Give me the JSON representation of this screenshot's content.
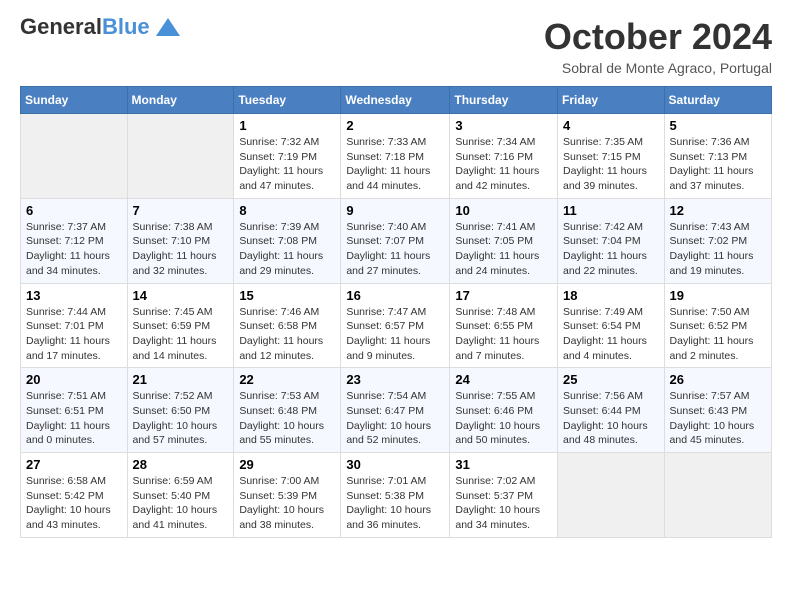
{
  "header": {
    "logo_line1": "General",
    "logo_line2": "Blue",
    "month": "October 2024",
    "location": "Sobral de Monte Agraco, Portugal"
  },
  "days_of_week": [
    "Sunday",
    "Monday",
    "Tuesday",
    "Wednesday",
    "Thursday",
    "Friday",
    "Saturday"
  ],
  "weeks": [
    [
      {
        "day": null,
        "sunrise": null,
        "sunset": null,
        "daylight": null
      },
      {
        "day": null,
        "sunrise": null,
        "sunset": null,
        "daylight": null
      },
      {
        "day": "1",
        "sunrise": "Sunrise: 7:32 AM",
        "sunset": "Sunset: 7:19 PM",
        "daylight": "Daylight: 11 hours and 47 minutes."
      },
      {
        "day": "2",
        "sunrise": "Sunrise: 7:33 AM",
        "sunset": "Sunset: 7:18 PM",
        "daylight": "Daylight: 11 hours and 44 minutes."
      },
      {
        "day": "3",
        "sunrise": "Sunrise: 7:34 AM",
        "sunset": "Sunset: 7:16 PM",
        "daylight": "Daylight: 11 hours and 42 minutes."
      },
      {
        "day": "4",
        "sunrise": "Sunrise: 7:35 AM",
        "sunset": "Sunset: 7:15 PM",
        "daylight": "Daylight: 11 hours and 39 minutes."
      },
      {
        "day": "5",
        "sunrise": "Sunrise: 7:36 AM",
        "sunset": "Sunset: 7:13 PM",
        "daylight": "Daylight: 11 hours and 37 minutes."
      }
    ],
    [
      {
        "day": "6",
        "sunrise": "Sunrise: 7:37 AM",
        "sunset": "Sunset: 7:12 PM",
        "daylight": "Daylight: 11 hours and 34 minutes."
      },
      {
        "day": "7",
        "sunrise": "Sunrise: 7:38 AM",
        "sunset": "Sunset: 7:10 PM",
        "daylight": "Daylight: 11 hours and 32 minutes."
      },
      {
        "day": "8",
        "sunrise": "Sunrise: 7:39 AM",
        "sunset": "Sunset: 7:08 PM",
        "daylight": "Daylight: 11 hours and 29 minutes."
      },
      {
        "day": "9",
        "sunrise": "Sunrise: 7:40 AM",
        "sunset": "Sunset: 7:07 PM",
        "daylight": "Daylight: 11 hours and 27 minutes."
      },
      {
        "day": "10",
        "sunrise": "Sunrise: 7:41 AM",
        "sunset": "Sunset: 7:05 PM",
        "daylight": "Daylight: 11 hours and 24 minutes."
      },
      {
        "day": "11",
        "sunrise": "Sunrise: 7:42 AM",
        "sunset": "Sunset: 7:04 PM",
        "daylight": "Daylight: 11 hours and 22 minutes."
      },
      {
        "day": "12",
        "sunrise": "Sunrise: 7:43 AM",
        "sunset": "Sunset: 7:02 PM",
        "daylight": "Daylight: 11 hours and 19 minutes."
      }
    ],
    [
      {
        "day": "13",
        "sunrise": "Sunrise: 7:44 AM",
        "sunset": "Sunset: 7:01 PM",
        "daylight": "Daylight: 11 hours and 17 minutes."
      },
      {
        "day": "14",
        "sunrise": "Sunrise: 7:45 AM",
        "sunset": "Sunset: 6:59 PM",
        "daylight": "Daylight: 11 hours and 14 minutes."
      },
      {
        "day": "15",
        "sunrise": "Sunrise: 7:46 AM",
        "sunset": "Sunset: 6:58 PM",
        "daylight": "Daylight: 11 hours and 12 minutes."
      },
      {
        "day": "16",
        "sunrise": "Sunrise: 7:47 AM",
        "sunset": "Sunset: 6:57 PM",
        "daylight": "Daylight: 11 hours and 9 minutes."
      },
      {
        "day": "17",
        "sunrise": "Sunrise: 7:48 AM",
        "sunset": "Sunset: 6:55 PM",
        "daylight": "Daylight: 11 hours and 7 minutes."
      },
      {
        "day": "18",
        "sunrise": "Sunrise: 7:49 AM",
        "sunset": "Sunset: 6:54 PM",
        "daylight": "Daylight: 11 hours and 4 minutes."
      },
      {
        "day": "19",
        "sunrise": "Sunrise: 7:50 AM",
        "sunset": "Sunset: 6:52 PM",
        "daylight": "Daylight: 11 hours and 2 minutes."
      }
    ],
    [
      {
        "day": "20",
        "sunrise": "Sunrise: 7:51 AM",
        "sunset": "Sunset: 6:51 PM",
        "daylight": "Daylight: 11 hours and 0 minutes."
      },
      {
        "day": "21",
        "sunrise": "Sunrise: 7:52 AM",
        "sunset": "Sunset: 6:50 PM",
        "daylight": "Daylight: 10 hours and 57 minutes."
      },
      {
        "day": "22",
        "sunrise": "Sunrise: 7:53 AM",
        "sunset": "Sunset: 6:48 PM",
        "daylight": "Daylight: 10 hours and 55 minutes."
      },
      {
        "day": "23",
        "sunrise": "Sunrise: 7:54 AM",
        "sunset": "Sunset: 6:47 PM",
        "daylight": "Daylight: 10 hours and 52 minutes."
      },
      {
        "day": "24",
        "sunrise": "Sunrise: 7:55 AM",
        "sunset": "Sunset: 6:46 PM",
        "daylight": "Daylight: 10 hours and 50 minutes."
      },
      {
        "day": "25",
        "sunrise": "Sunrise: 7:56 AM",
        "sunset": "Sunset: 6:44 PM",
        "daylight": "Daylight: 10 hours and 48 minutes."
      },
      {
        "day": "26",
        "sunrise": "Sunrise: 7:57 AM",
        "sunset": "Sunset: 6:43 PM",
        "daylight": "Daylight: 10 hours and 45 minutes."
      }
    ],
    [
      {
        "day": "27",
        "sunrise": "Sunrise: 6:58 AM",
        "sunset": "Sunset: 5:42 PM",
        "daylight": "Daylight: 10 hours and 43 minutes."
      },
      {
        "day": "28",
        "sunrise": "Sunrise: 6:59 AM",
        "sunset": "Sunset: 5:40 PM",
        "daylight": "Daylight: 10 hours and 41 minutes."
      },
      {
        "day": "29",
        "sunrise": "Sunrise: 7:00 AM",
        "sunset": "Sunset: 5:39 PM",
        "daylight": "Daylight: 10 hours and 38 minutes."
      },
      {
        "day": "30",
        "sunrise": "Sunrise: 7:01 AM",
        "sunset": "Sunset: 5:38 PM",
        "daylight": "Daylight: 10 hours and 36 minutes."
      },
      {
        "day": "31",
        "sunrise": "Sunrise: 7:02 AM",
        "sunset": "Sunset: 5:37 PM",
        "daylight": "Daylight: 10 hours and 34 minutes."
      },
      {
        "day": null,
        "sunrise": null,
        "sunset": null,
        "daylight": null
      },
      {
        "day": null,
        "sunrise": null,
        "sunset": null,
        "daylight": null
      }
    ]
  ]
}
